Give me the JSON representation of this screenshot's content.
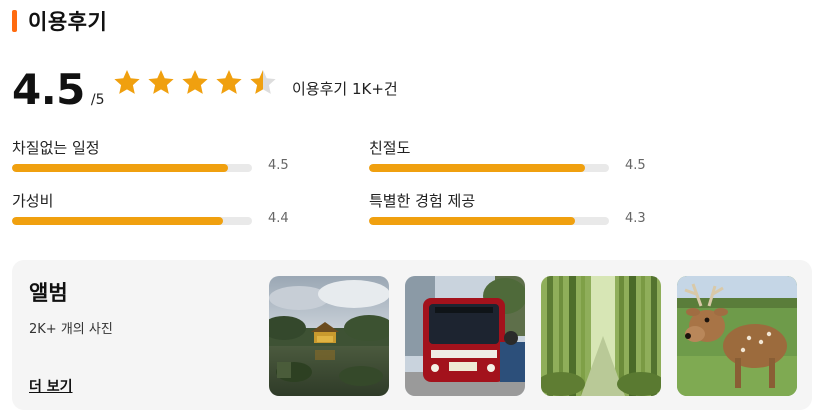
{
  "section": {
    "title": "이용후기"
  },
  "score": {
    "value": "4.5",
    "max": "/5",
    "rating": 4.5,
    "star_count": 5,
    "review_count": "이용후기 1K+건"
  },
  "metrics": [
    {
      "label": "차질없는 일정",
      "value": "4.5",
      "ratio": 0.9
    },
    {
      "label": "친절도",
      "value": "4.5",
      "ratio": 0.9
    },
    {
      "label": "가성비",
      "value": "4.4",
      "ratio": 0.88
    },
    {
      "label": "특별한 경험 제공",
      "value": "4.3",
      "ratio": 0.86
    }
  ],
  "album": {
    "title": "앨범",
    "subtitle": "2K+ 개의 사진",
    "more_label": "더 보기",
    "photos": [
      "golden-pavilion-photo",
      "red-bus-photo",
      "bamboo-forest-photo",
      "deer-photo"
    ]
  },
  "colors": {
    "accent": "#ff6b10",
    "star": "#f0a00f",
    "star_empty": "#dddddd",
    "bar_fill": "#f0a00f",
    "bar_track": "#e9e9e9",
    "card_bg": "#f5f5f5"
  }
}
